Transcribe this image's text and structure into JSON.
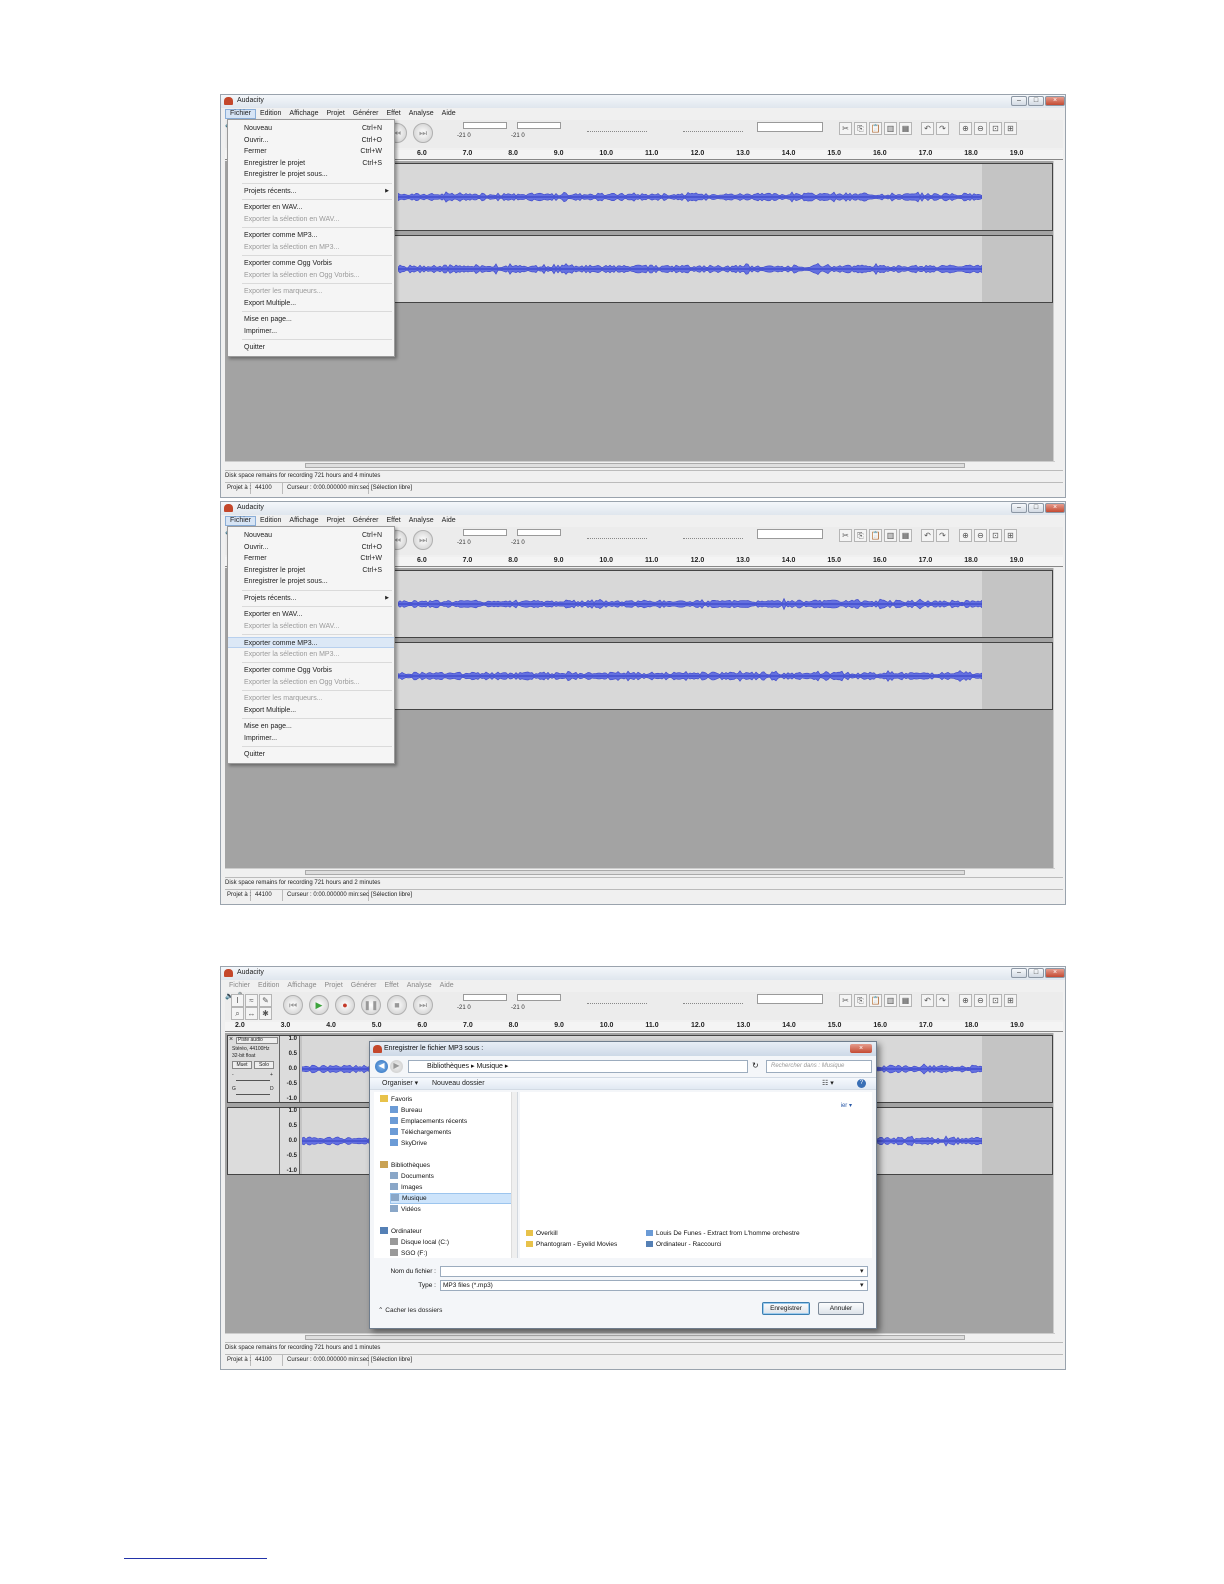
{
  "screens": [
    {
      "window_title": "Audacity",
      "menu_bar": [
        "Fichier",
        "Edition",
        "Affichage",
        "Projet",
        "Générer",
        "Effet",
        "Analyse",
        "Aide"
      ],
      "active_menu": "Fichier",
      "file_menu": [
        {
          "label": "Nouveau",
          "shortcut": "Ctrl+N",
          "enabled": true
        },
        {
          "label": "Ouvrir...",
          "shortcut": "Ctrl+O",
          "enabled": true
        },
        {
          "label": "Fermer",
          "shortcut": "Ctrl+W",
          "enabled": true
        },
        {
          "label": "Enregistrer le projet",
          "shortcut": "Ctrl+S",
          "enabled": true
        },
        {
          "label": "Enregistrer le projet sous...",
          "shortcut": "",
          "enabled": true
        },
        {
          "label": "Projets récents...",
          "shortcut": "",
          "enabled": true,
          "submenu": true
        },
        {
          "label": "Exporter en WAV...",
          "shortcut": "",
          "enabled": true
        },
        {
          "label": "Exporter la sélection en WAV...",
          "shortcut": "",
          "enabled": false
        },
        {
          "label": "Exporter comme MP3...",
          "shortcut": "",
          "enabled": true
        },
        {
          "label": "Exporter la sélection en MP3...",
          "shortcut": "",
          "enabled": false
        },
        {
          "label": "Exporter comme Ogg Vorbis",
          "shortcut": "",
          "enabled": true
        },
        {
          "label": "Exporter la sélection en Ogg Vorbis...",
          "shortcut": "",
          "enabled": false
        },
        {
          "label": "Exporter les marqueurs...",
          "shortcut": "",
          "enabled": false
        },
        {
          "label": "Export Multiple...",
          "shortcut": "",
          "enabled": true
        },
        {
          "label": "Mise en page...",
          "shortcut": "",
          "enabled": true
        },
        {
          "label": "Imprimer...",
          "shortcut": "",
          "enabled": true
        },
        {
          "label": "Quitter",
          "shortcut": "",
          "enabled": true
        }
      ],
      "highlighted_item": "",
      "ruler_ticks": [
        "6.0",
        "7.0",
        "8.0",
        "9.0",
        "10.0",
        "11.0",
        "12.0",
        "13.0",
        "14.0",
        "15.0",
        "16.0",
        "17.0",
        "18.0",
        "19.0"
      ],
      "meter_scale": "-21 0",
      "status_message": "Disk space remains for recording 721 hours and 4 minutes",
      "status_bar": {
        "rate_label": "Projet à :",
        "rate_value": "44100",
        "cursor": "Curseur : 0:00.000000 min:sec",
        "selection": "[Sélection libre]"
      }
    },
    {
      "window_title": "Audacity",
      "menu_bar": [
        "Fichier",
        "Edition",
        "Affichage",
        "Projet",
        "Générer",
        "Effet",
        "Analyse",
        "Aide"
      ],
      "active_menu": "Fichier",
      "file_menu": [
        {
          "label": "Nouveau",
          "shortcut": "Ctrl+N",
          "enabled": true
        },
        {
          "label": "Ouvrir...",
          "shortcut": "Ctrl+O",
          "enabled": true
        },
        {
          "label": "Fermer",
          "shortcut": "Ctrl+W",
          "enabled": true
        },
        {
          "label": "Enregistrer le projet",
          "shortcut": "Ctrl+S",
          "enabled": true
        },
        {
          "label": "Enregistrer le projet sous...",
          "shortcut": "",
          "enabled": true
        },
        {
          "label": "Projets récents...",
          "shortcut": "",
          "enabled": true,
          "submenu": true
        },
        {
          "label": "Exporter en WAV...",
          "shortcut": "",
          "enabled": true
        },
        {
          "label": "Exporter la sélection en WAV...",
          "shortcut": "",
          "enabled": false
        },
        {
          "label": "Exporter comme MP3...",
          "shortcut": "",
          "enabled": true
        },
        {
          "label": "Exporter la sélection en MP3...",
          "shortcut": "",
          "enabled": false
        },
        {
          "label": "Exporter comme Ogg Vorbis",
          "shortcut": "",
          "enabled": true
        },
        {
          "label": "Exporter la sélection en Ogg Vorbis...",
          "shortcut": "",
          "enabled": false
        },
        {
          "label": "Exporter les marqueurs...",
          "shortcut": "",
          "enabled": false
        },
        {
          "label": "Export Multiple...",
          "shortcut": "",
          "enabled": true
        },
        {
          "label": "Mise en page...",
          "shortcut": "",
          "enabled": true
        },
        {
          "label": "Imprimer...",
          "shortcut": "",
          "enabled": true
        },
        {
          "label": "Quitter",
          "shortcut": "",
          "enabled": true
        }
      ],
      "highlighted_item": "Exporter comme MP3...",
      "ruler_ticks": [
        "6.0",
        "7.0",
        "8.0",
        "9.0",
        "10.0",
        "11.0",
        "12.0",
        "13.0",
        "14.0",
        "15.0",
        "16.0",
        "17.0",
        "18.0",
        "19.0"
      ],
      "meter_scale": "-21 0",
      "status_message": "Disk space remains for recording 721 hours and 2 minutes",
      "status_bar": {
        "rate_label": "Projet à :",
        "rate_value": "44100",
        "cursor": "Curseur : 0:00.000000 min:sec",
        "selection": "[Sélection libre]"
      }
    },
    {
      "window_title": "Audacity",
      "menu_bar": [
        "Fichier",
        "Edition",
        "Affichage",
        "Projet",
        "Générer",
        "Effet",
        "Analyse",
        "Aide"
      ],
      "ruler_ticks": [
        "2.0",
        "3.0",
        "4.0",
        "5.0",
        "6.0",
        "7.0",
        "8.0",
        "9.0",
        "10.0",
        "11.0",
        "12.0",
        "13.0",
        "14.0",
        "15.0",
        "16.0",
        "17.0",
        "18.0",
        "19.0"
      ],
      "meter_scale": "-21 0",
      "track_panel": {
        "name": "Piste audio",
        "info1": "Stéréo, 44100Hz",
        "info2": "32-bit float",
        "mute": "Muet",
        "solo": "Solo",
        "gain_minus": "-",
        "gain_plus": "+",
        "pan_left": "G",
        "pan_right": "D"
      },
      "y_axis_labels": [
        "1.0",
        "0.5",
        "0.0",
        "-0.5",
        "-1.0"
      ],
      "save_dialog": {
        "title": "Enregistrer le fichier MP3 sous :",
        "breadcrumb": [
          "Bibliothèques",
          "Musique"
        ],
        "search_placeholder": "Rechercher dans : Musique",
        "organize": "Organiser ▾",
        "new_folder": "Nouveau dossier",
        "arrange_partial": "ier ▾",
        "nav_favorites": "Favoris",
        "nav_favorites_items": [
          "Bureau",
          "Emplacements récents",
          "Téléchargements",
          "SkyDrive"
        ],
        "nav_libraries": "Bibliothèques",
        "nav_libraries_items": [
          "Documents",
          "Images",
          "Musique",
          "Vidéos"
        ],
        "nav_computer": "Ordinateur",
        "nav_computer_items": [
          "Disque local (C:)",
          "SGO (F:)"
        ],
        "files": [
          "Overkill",
          "Phantogram - Eyelid Movies",
          "Louis De Funes - Extract from L'homme orchestre",
          "Ordinateur - Raccourci"
        ],
        "filename_label": "Nom du fichier :",
        "filename_value": "",
        "type_label": "Type :",
        "type_value": "MP3 files (*.mp3)",
        "hide_folders": "Cacher les dossiers",
        "save_button": "Enregistrer",
        "cancel_button": "Annuler"
      },
      "status_message": "Disk space remains for recording 721 hours and 1 minutes",
      "status_bar": {
        "rate_label": "Projet à :",
        "rate_value": "44100",
        "cursor": "Curseur : 0:00.000000 min:sec",
        "selection": "[Sélection libre]"
      }
    }
  ],
  "colors": {
    "waveform": "#3b46c9",
    "waveform_fill": "#6470e0",
    "track_bg": "#d8d8d8",
    "workspace": "#a3a3a3",
    "selection_highlight": "#dce8f6"
  }
}
